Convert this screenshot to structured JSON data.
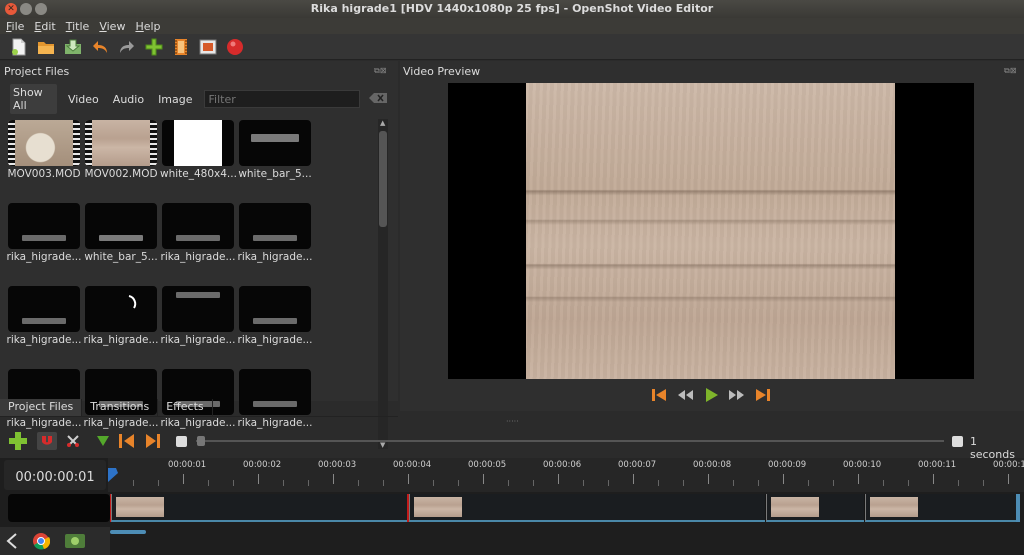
{
  "window": {
    "title": "Rika higrade1 [HDV 1440x1080p 25 fps] - OpenShot Video Editor"
  },
  "menu": [
    "File",
    "Edit",
    "Title",
    "View",
    "Help"
  ],
  "toolbar": {
    "icons": [
      "new-project-icon",
      "open-project-icon",
      "save-project-icon",
      "undo-icon",
      "redo-icon",
      "import-files-icon",
      "profile-icon",
      "fullscreen-icon",
      "export-video-icon"
    ]
  },
  "project_files": {
    "title": "Project Files",
    "filters": [
      "Show All",
      "Video",
      "Audio",
      "Image"
    ],
    "filter_placeholder": "Filter",
    "items": [
      {
        "label": "MOV003.MOD",
        "kind": "video"
      },
      {
        "label": "MOV002.MOD",
        "kind": "video"
      },
      {
        "label": "white_480x4...",
        "kind": "white"
      },
      {
        "label": "white_bar_5...",
        "kind": "bar"
      },
      {
        "label": "rika_higrade...",
        "kind": "title"
      },
      {
        "label": "white_bar_5...",
        "kind": "bar"
      },
      {
        "label": "rika_higrade...",
        "kind": "title"
      },
      {
        "label": "rika_higrade...",
        "kind": "title"
      },
      {
        "label": "rika_higrade...",
        "kind": "title"
      },
      {
        "label": "rika_higrade...",
        "kind": "spinner"
      },
      {
        "label": "rika_higrade...",
        "kind": "title-top"
      },
      {
        "label": "rika_higrade...",
        "kind": "title"
      },
      {
        "label": "rika_higrade...",
        "kind": "title"
      },
      {
        "label": "rika_higrade...",
        "kind": "title"
      },
      {
        "label": "rika_higrade...",
        "kind": "title"
      },
      {
        "label": "rika_higrade...",
        "kind": "title"
      }
    ]
  },
  "bottom_tabs": [
    "Project Files",
    "Transitions",
    "Effects"
  ],
  "video_preview": {
    "title": "Video Preview"
  },
  "timeline": {
    "time": "00:00:00:01",
    "zoom_label": "1 seconds",
    "ticks": [
      "00:00:01",
      "00:00:02",
      "00:00:03",
      "00:00:04",
      "00:00:05",
      "00:00:06",
      "00:00:07",
      "00:00:08",
      "00:00:09",
      "00:00:10",
      "00:00:11",
      "00:00:1"
    ]
  },
  "colors": {
    "accent_orange": "#e8842a",
    "play_green": "#7fb52b",
    "record_red": "#d62b2b",
    "clip_blue": "#4a88a8"
  }
}
